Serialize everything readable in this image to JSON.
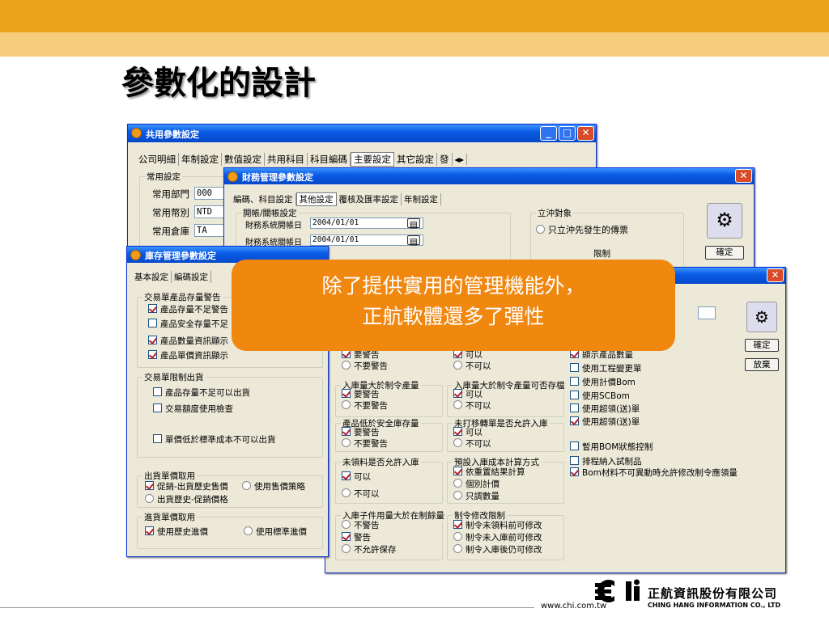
{
  "slide": {
    "title": "參數化的設計",
    "callout_line1": "除了提供實用的管理機能外，",
    "callout_line2": "正航軟體還多了彈性"
  },
  "brand": {
    "company_cn": "正航資訊股份有限公司",
    "company_en": "CHING HANG INFORMATION CO., LTD",
    "url": "www.chi.com.tw",
    "accent": "#ECA31A",
    "callout": "#F0870F"
  },
  "win1": {
    "title": "共用參數設定",
    "tabs": [
      "公司明細",
      "年制設定",
      "數值設定",
      "共用科目",
      "科目編碼",
      "主要設定",
      "其它設定",
      "發"
    ],
    "group": "常用設定",
    "rows": [
      {
        "label": "常用部門",
        "value": "000"
      },
      {
        "label": "常用幣別",
        "value": "NTD"
      },
      {
        "label": "常用倉庫",
        "value": "TA"
      }
    ]
  },
  "win2": {
    "title": "財務管理參數設定",
    "tabs": [
      "編碼、科目設定",
      "其他設定",
      "覆核及匯率設定",
      "年制設定"
    ],
    "group": "開帳/關帳設定",
    "rows": [
      {
        "label": "財務系統開帳日",
        "value": "2004/01/01"
      },
      {
        "label": "財務系統關帳日",
        "value": "2004/01/01"
      }
    ],
    "group2": "立沖對象",
    "opt1": "只立沖先發生的傳票",
    "ok": "確定",
    "peek": "限制"
  },
  "win3": {
    "title": "庫存管理參數設定",
    "tabs": [
      "基本設定",
      "編碼設定"
    ],
    "g1": "交易單產品存量警告",
    "g1_items": [
      {
        "t": "產品存量不足警告",
        "c": true
      },
      {
        "t": "產品安全存量不足",
        "c": false
      },
      {
        "t": "產品數量資訊顯示",
        "c": true
      },
      {
        "t": "產品單價資訊顯示",
        "c": true
      }
    ],
    "g2": "交易單限制出貨",
    "g2_items": [
      "產品存量不足可以出貨",
      "交易額度使用檢查",
      "單價低於標準成本不可以出貨"
    ],
    "g3": "出貨單價取用",
    "g3_a": "促銷-出貨歷史售價",
    "g3_b": "使用售價策略",
    "g3_c": "出貨歷史-促銷價格",
    "g4": "進貨單價取用",
    "g4_a": "使用歷史進價",
    "g4_b": "使用標準進價"
  },
  "win4": {
    "ok": "確定",
    "cancel": "放棄",
    "c1": [
      {
        "g": "",
        "a": "要警告",
        "b": "不要警告"
      },
      {
        "g": "入庫量大於制令產量",
        "a": "要警告",
        "b": "不要警告"
      },
      {
        "g": "產品低於安全庫存量",
        "a": "要警告",
        "b": "不要警告"
      },
      {
        "g": "未領料是否允許入庫",
        "a": "可以",
        "b": "不可以"
      }
    ],
    "c2": [
      {
        "g": "",
        "a": "可以",
        "b": "不可以"
      },
      {
        "g": "入庫量大於制令產量可否存檔",
        "a": "可以",
        "b": "不可以"
      },
      {
        "g": "未打移轉單是否允許入庫",
        "a": "可以",
        "b": "不可以"
      }
    ],
    "c3g": "預設入庫成本計算方式",
    "c3": [
      "依重置結果計算",
      "個別計價",
      "只調數量"
    ],
    "c4g": "入庫子件用量大於在制餘量",
    "c4": [
      "不警告",
      "警告",
      "不允許保存"
    ],
    "c5g": "制令修改限制",
    "c5": [
      "制令未領料前可修改",
      "制令未入庫前可修改",
      "制令入庫後仍可修改"
    ],
    "right": [
      {
        "t": "顯示產品數量",
        "c": true
      },
      {
        "t": "使用工程變更單",
        "c": false
      },
      {
        "t": "使用計價Bom",
        "c": false
      },
      {
        "t": "使用SCBom",
        "c": false
      },
      {
        "t": "使用超領(送)單",
        "c": false
      },
      {
        "t": "使用超領(送)單",
        "c": true
      },
      {
        "t": "暫用BOM狀態控制",
        "c": false
      },
      {
        "t": "排程納入試制品",
        "c": false
      },
      {
        "t": "Bom材料不可異動時允許修改制令應領量",
        "c": true
      }
    ]
  }
}
